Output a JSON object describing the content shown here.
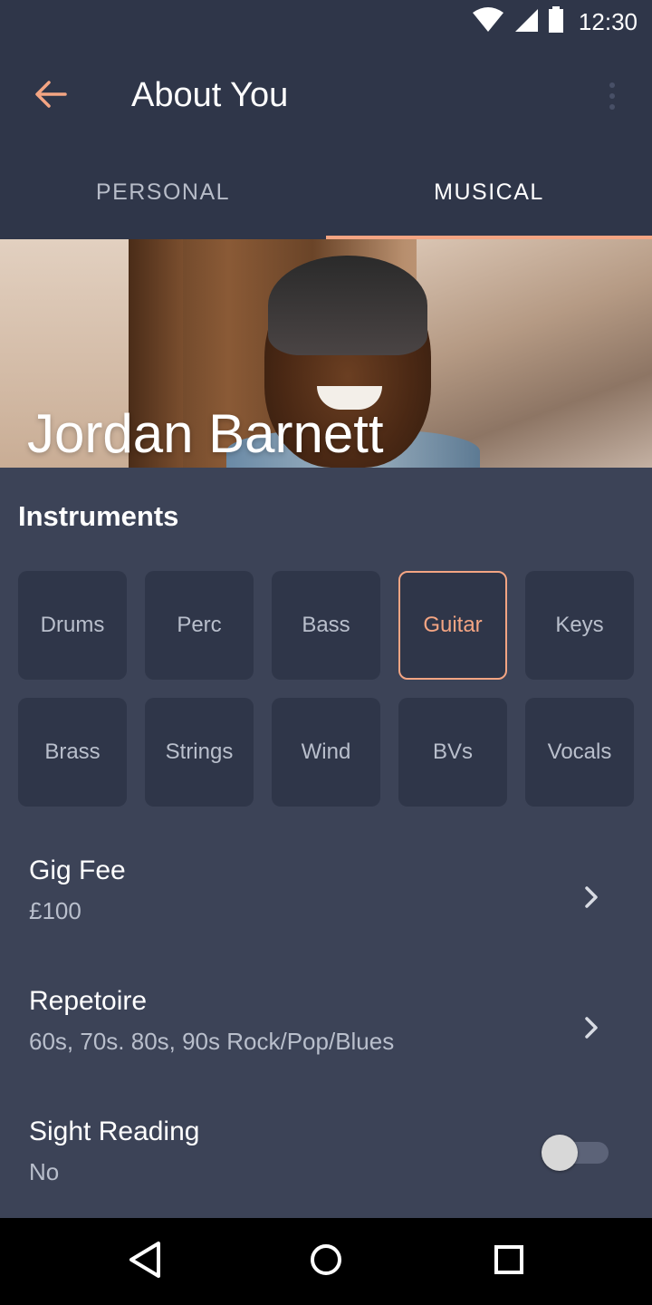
{
  "status_bar": {
    "time": "12:30",
    "icons": [
      "wifi-icon",
      "signal-icon",
      "battery-icon"
    ]
  },
  "app_bar": {
    "title": "About You",
    "back_icon": "arrow-back-icon",
    "menu_icon": "more-vert-icon"
  },
  "tabs": [
    {
      "label": "PERSONAL",
      "active": false
    },
    {
      "label": "MUSICAL",
      "active": true
    }
  ],
  "profile": {
    "name": "Jordan Barnett"
  },
  "instruments": {
    "title": "Instruments",
    "items": [
      {
        "label": "Drums",
        "selected": false
      },
      {
        "label": "Perc",
        "selected": false
      },
      {
        "label": "Bass",
        "selected": false
      },
      {
        "label": "Guitar",
        "selected": true
      },
      {
        "label": "Keys",
        "selected": false
      },
      {
        "label": "Brass",
        "selected": false
      },
      {
        "label": "Strings",
        "selected": false
      },
      {
        "label": "Wind",
        "selected": false
      },
      {
        "label": "BVs",
        "selected": false
      },
      {
        "label": "Vocals",
        "selected": false
      }
    ]
  },
  "settings": {
    "gig_fee": {
      "label": "Gig Fee",
      "value": "£100"
    },
    "repertoire": {
      "label": "Repetoire",
      "value": "60s, 70s. 80s, 90s Rock/Pop/Blues"
    },
    "sight_reading": {
      "label": "Sight Reading",
      "value": "No",
      "enabled": false
    }
  },
  "colors": {
    "accent": "#f4a583",
    "background": "#3c4357",
    "surface": "#2f3649",
    "secondary_text": "#b9bfcc"
  },
  "nav_bar": {
    "icons": [
      "back-triangle-icon",
      "home-circle-icon",
      "recents-square-icon"
    ]
  }
}
